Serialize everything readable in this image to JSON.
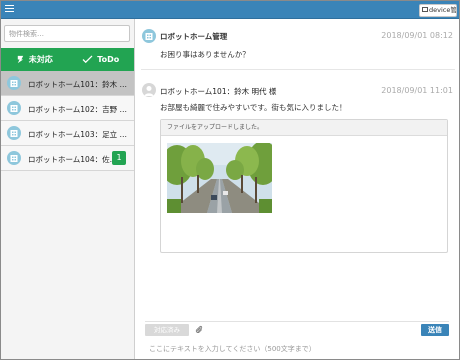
{
  "topbar": {
    "device_label": "device管理"
  },
  "sidebar": {
    "search_placeholder": "物件検索…",
    "tabs": [
      {
        "label": "未対応"
      },
      {
        "label": "ToDo"
      }
    ],
    "items": [
      {
        "label": "ロボットホーム101：鈴木 …",
        "active": true
      },
      {
        "label": "ロボットホーム102：吉野 …"
      },
      {
        "label": "ロボットホーム103：足立 …"
      },
      {
        "label": "ロボットホーム104：佐…",
        "badge": "1"
      }
    ]
  },
  "messages": [
    {
      "sender": "ロボットホーム管理",
      "time": "2018/09/01 08:12",
      "body": "お困り事はありませんか？"
    },
    {
      "sender": "ロボットホーム101：鈴木 明代 様",
      "time": "2018/09/01 11:01",
      "body": "お部屋も綺麗で住みやすいです。街も気に入りました！",
      "attachment_header": "ファイルをアップロードしました。"
    }
  ],
  "composer": {
    "status_label": "対応済み",
    "send_label": "送信",
    "placeholder": "ここにテキストを入力してください（500文字まで）"
  },
  "colors": {
    "topbar": "#3a84b8",
    "tabs": "#22a452",
    "badge": "#22a452",
    "send_button": "#3a84b8"
  }
}
